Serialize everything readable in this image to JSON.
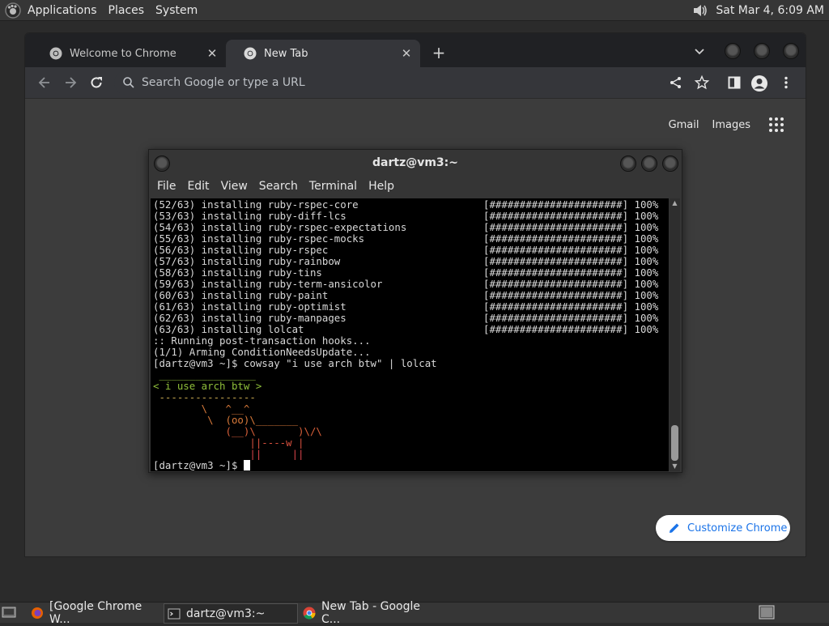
{
  "top_panel": {
    "menus": [
      "Applications",
      "Places",
      "System"
    ],
    "clock": "Sat Mar  4,  6:09 AM",
    "icons": [
      "foot-logo-icon",
      "speaker-icon"
    ]
  },
  "chrome": {
    "tabs": [
      {
        "label": "Welcome to Chrome",
        "icon": "chrome-logo-icon",
        "active": false
      },
      {
        "label": "New Tab",
        "icon": "chrome-logo-icon",
        "active": true
      }
    ],
    "new_tab_symbol": "+",
    "omnibox_placeholder": "Search Google or type a URL",
    "ntp": {
      "links": [
        "Gmail",
        "Images"
      ],
      "customize_label": "Customize Chrome"
    }
  },
  "terminal": {
    "title": "dartz@vm3:~",
    "menu": [
      "File",
      "Edit",
      "View",
      "Search",
      "Terminal",
      "Help"
    ],
    "install_lines": [
      {
        "text": "(52/63) installing ruby-rspec-core",
        "bar": "[######################] 100%"
      },
      {
        "text": "(53/63) installing ruby-diff-lcs",
        "bar": "[######################] 100%"
      },
      {
        "text": "(54/63) installing ruby-rspec-expectations",
        "bar": "[######################] 100%"
      },
      {
        "text": "(55/63) installing ruby-rspec-mocks",
        "bar": "[######################] 100%"
      },
      {
        "text": "(56/63) installing ruby-rspec",
        "bar": "[######################] 100%"
      },
      {
        "text": "(57/63) installing ruby-rainbow",
        "bar": "[######################] 100%"
      },
      {
        "text": "(58/63) installing ruby-tins",
        "bar": "[######################] 100%"
      },
      {
        "text": "(59/63) installing ruby-term-ansicolor",
        "bar": "[######################] 100%"
      },
      {
        "text": "(60/63) installing ruby-paint",
        "bar": "[######################] 100%"
      },
      {
        "text": "(61/63) installing ruby-optimist",
        "bar": "[######################] 100%"
      },
      {
        "text": "(62/63) installing ruby-manpages",
        "bar": "[######################] 100%"
      },
      {
        "text": "(63/63) installing lolcat",
        "bar": "[######################] 100%"
      }
    ],
    "after_lines": [
      ":: Running post-transaction hooks...",
      "(1/1) Arming ConditionNeedsUpdate...",
      "[dartz@vm3 ~]$ cowsay \"i use arch btw\" | lolcat"
    ],
    "cowsay": [
      " ________________",
      "< i use arch btw >",
      " ----------------",
      "        \\   ^__^",
      "         \\  (oo)\\_______",
      "            (__)\\       )\\/\\",
      "                ||----w |",
      "                ||     ||"
    ],
    "prompt": "[dartz@vm3 ~]$ "
  },
  "bottom_panel": {
    "tasks": [
      {
        "label": "[Google Chrome W...",
        "icon": "firefox-icon"
      },
      {
        "label": "dartz@vm3:~",
        "icon": "terminal-icon"
      },
      {
        "label": "New Tab - Google C...",
        "icon": "chrome-logo-icon"
      }
    ]
  }
}
